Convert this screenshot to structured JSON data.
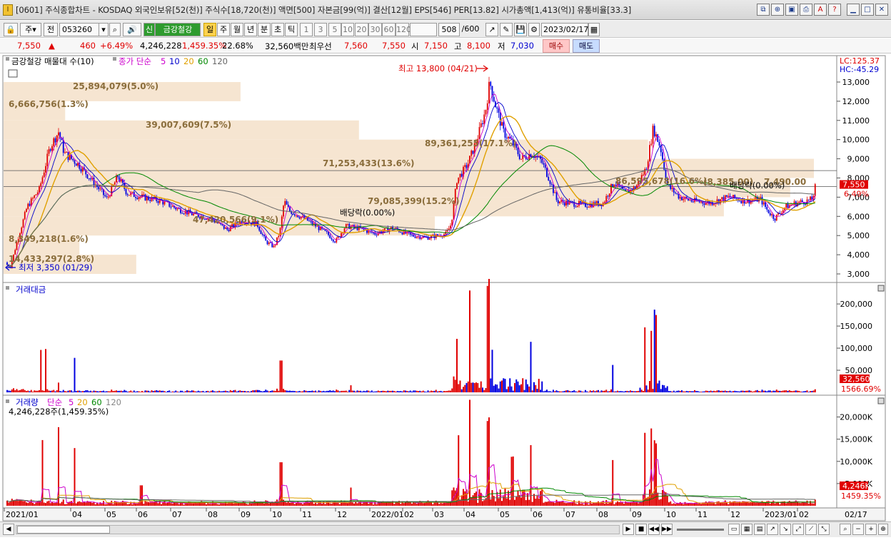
{
  "window": {
    "title": "[0601] 주식종합차트 - KOSDAQ 외국인보유[52(천)] 주식수[18,720(천)] 액면[500] 자본금[99(억)] 결산[12월] EPS[546] PER[13.82] 시가총액[1,413(억)] 유통비율[33.3]",
    "app_icon": "I",
    "buttons": [
      "restore",
      "zoom",
      "pin",
      "print",
      "fit",
      "help",
      "minimize",
      "maximize",
      "close"
    ]
  },
  "toolbar": {
    "type_select": "주",
    "prev_label": "전",
    "code": "053260",
    "stock_badge": "신",
    "stock_name": "금강철강",
    "periods": [
      "일",
      "주",
      "월",
      "년",
      "분",
      "초",
      "틱"
    ],
    "active_period": "일",
    "intervals": [
      "1",
      "3",
      "5",
      "10",
      "20",
      "30",
      "60",
      "120"
    ],
    "count_value": "508",
    "count_total": "/600",
    "date": "2023/02/17"
  },
  "quote": {
    "price": "7,550",
    "arrow": "▲",
    "change": "460",
    "change_pct": "+6.49%",
    "volume": "4,246,228",
    "volume_ratio": "1,459.35%",
    "turnover": "22.68%",
    "amount": "32,560백만",
    "priority_label": "최우선",
    "bid": "7,560",
    "ask": "7,550",
    "open_label": "시",
    "open": "7,150",
    "high_label": "고",
    "high": "8,100",
    "low_label": "저",
    "low": "7,030",
    "buy_label": "매수",
    "sell_label": "매도"
  },
  "price_panel": {
    "legend_title": "금강철강 매물대 수(10)",
    "ma_label": "종가 단순",
    "ma_periods": [
      "5",
      "10",
      "20",
      "60",
      "120"
    ],
    "ma_colors": [
      "#cc00cc",
      "#0000cc",
      "#e0a000",
      "#008800",
      "#666666"
    ],
    "lc": "LC:125.37",
    "hc": "HC:-45.29",
    "high_note": "최고 13,800 (04/21)",
    "low_note": "최저 3,350 (01/29)",
    "dividend_notes": [
      "배당락(0.00%)",
      "배당락(0.00%)"
    ],
    "current_price_tag": "7,550",
    "current_pct_tag": "6.49%",
    "y_ticks": [
      "13,000",
      "12,000",
      "11,000",
      "10,000",
      "9,000",
      "8,000",
      "7,000",
      "6,000",
      "5,000",
      "4,000",
      "3,000"
    ],
    "volume_profile": [
      {
        "label": "14,433,297(2.8%)",
        "pct": 2.8
      },
      {
        "label": "8,349,218(1.6%)",
        "pct": 1.6
      },
      {
        "label": "47,420,566(9.1%)",
        "pct": 9.1
      },
      {
        "label": "79,085,399(15.2%)",
        "pct": 15.2
      },
      {
        "label": "86,595,678(16.6%)",
        "pct": 16.6
      },
      {
        "label": "89,361,255(17.1%)",
        "pct": 17.1
      },
      {
        "label": "71,253,433(13.6%)",
        "pct": 13.6
      },
      {
        "label": "39,007,609(7.5%)",
        "pct": 7.5
      },
      {
        "label": "6,666,756(1.3%)",
        "pct": 1.3
      },
      {
        "label": "25,894,079(5.0%)",
        "pct": 5.0
      }
    ],
    "extra_labels": [
      "(8,385.00)",
      "7,490.00"
    ]
  },
  "amount_panel": {
    "title": "거래대금",
    "y_ticks": [
      "200,000",
      "150,000",
      "100,000",
      "50,000"
    ],
    "current_tag": "32,560",
    "current_pct": "1566.69%"
  },
  "volume_panel": {
    "title": "거래량",
    "ma_label": "단순",
    "ma_periods": [
      "5",
      "20",
      "60",
      "120"
    ],
    "value_line": "4,246,228주(1,459.35%)",
    "y_ticks": [
      "20,000K",
      "15,000K",
      "10,000K",
      "5,000K"
    ],
    "current_tag": "4,246K",
    "current_pct": "1459.35%"
  },
  "x_axis": {
    "labels": [
      "2021/01",
      "04",
      "05",
      "06",
      "07",
      "08",
      "09",
      "10",
      "11",
      "12",
      "2022/01",
      "02",
      "03",
      "04",
      "05",
      "06",
      "07",
      "08",
      "09",
      "10",
      "11",
      "12",
      "2023/01",
      "02"
    ],
    "end_label": "02/17"
  },
  "statusbar": {
    "controls": [
      "play",
      "stop",
      "prev",
      "next",
      "zoom-out",
      "zoom-in",
      "add"
    ]
  }
}
